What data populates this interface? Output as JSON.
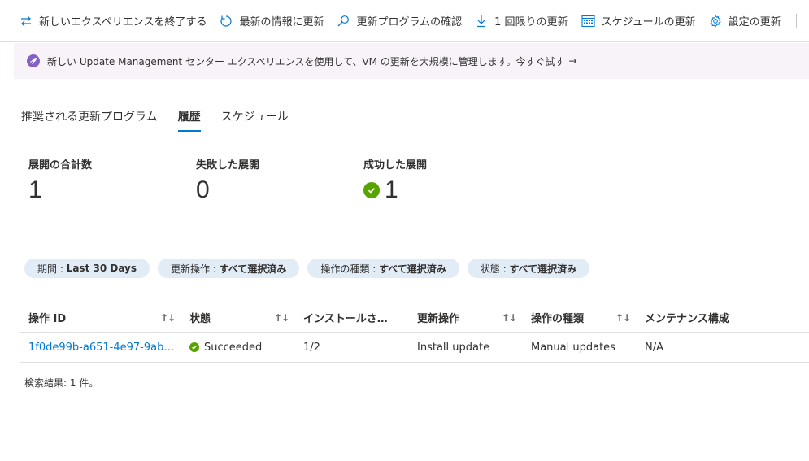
{
  "toolbar": {
    "items": [
      {
        "label": "新しいエクスペリエンスを終了する",
        "icon": "switch-arrows-icon"
      },
      {
        "label": "最新の情報に更新",
        "icon": "refresh-icon"
      },
      {
        "label": "更新プログラムの確認",
        "icon": "search-icon"
      },
      {
        "label": "1 回限りの更新",
        "icon": "download-icon"
      },
      {
        "label": "スケジュールの更新",
        "icon": "calendar-icon"
      },
      {
        "label": "設定の更新",
        "icon": "gear-icon"
      }
    ]
  },
  "banner": {
    "text": "新しい Update Management センター エクスペリエンスを使用して、VM の更新を大規模に管理します。今すぐ試す",
    "arrow": "→",
    "icon": "rocket-icon"
  },
  "tabs": [
    {
      "label": "推奨される更新プログラム",
      "active": false
    },
    {
      "label": "履歴",
      "active": true
    },
    {
      "label": "スケジュール",
      "active": false
    }
  ],
  "metrics": [
    {
      "label": "展開の合計数",
      "value": "1"
    },
    {
      "label": "失敗した展開",
      "value": "0"
    },
    {
      "label": "成功した展開",
      "value": "1",
      "icon": "success-check-icon"
    }
  ],
  "filters": [
    {
      "key": "期間 :",
      "value": "Last 30 Days"
    },
    {
      "key": "更新操作 :",
      "value": "すべて選択済み"
    },
    {
      "key": "操作の種類 :",
      "value": "すべて選択済み"
    },
    {
      "key": "状態 :",
      "value": "すべて選択済み"
    }
  ],
  "table": {
    "sort_glyph": "↑↓",
    "columns": [
      "操作 ID",
      "状態",
      "インストールされた...",
      "更新操作",
      "操作の種類",
      "メンテナンス構成"
    ],
    "rows": [
      {
        "id": "1f0de99b-a651-4e97-9ab7-ba...",
        "status": "Succeeded",
        "installed": "1/2",
        "operation": "Install update",
        "type": "Manual updates",
        "maintenance": "N/A"
      }
    ]
  },
  "result_text": "検索結果: 1 件。",
  "colors": {
    "accent": "#0078d4",
    "success": "#57a300",
    "banner_bg": "#f7f3f9",
    "pill_bg": "#e1ecf7"
  }
}
